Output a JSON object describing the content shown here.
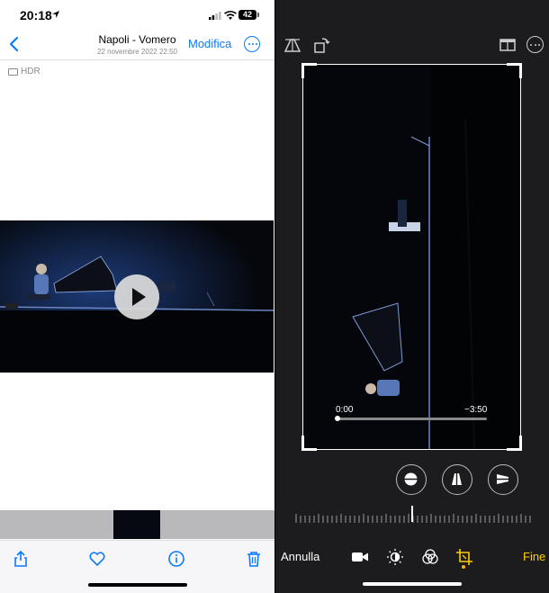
{
  "status": {
    "time": "20:18",
    "battery": "42"
  },
  "nav": {
    "title": "Napoli - Vomero",
    "date": "22 novembre 2022  22:50",
    "edit_label": "Modifica"
  },
  "hdr_label": "HDR",
  "editor": {
    "time_start": "0:00",
    "time_end": "−3:50",
    "cancel_label": "Annulla",
    "done_label": "Fine",
    "progress": 0
  },
  "colors": {
    "accent": "#0a7aff",
    "done": "#ffcc00"
  }
}
